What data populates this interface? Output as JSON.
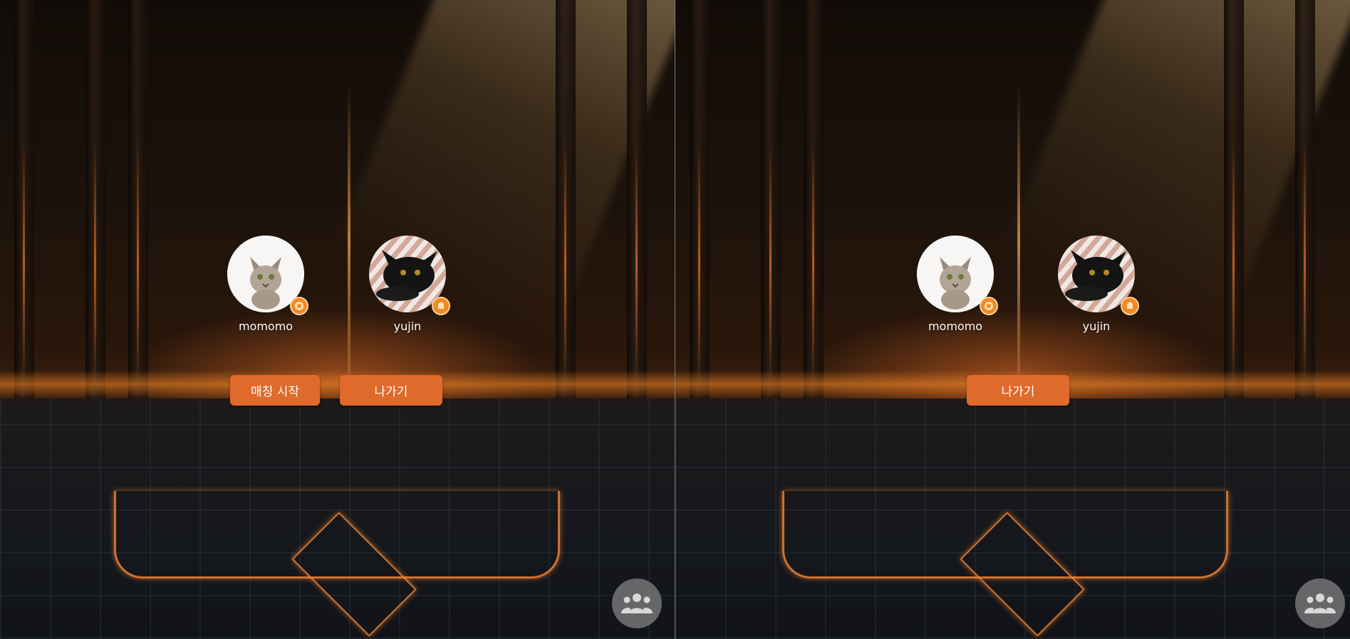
{
  "left_panel": {
    "players": [
      {
        "name": "momomo",
        "avatar": "tabby-kitten-avatar",
        "badge": "orange-level-badge-icon"
      },
      {
        "name": "yujin",
        "avatar": "black-kitten-avatar",
        "badge": "orange-level-badge-icon"
      }
    ],
    "buttons": {
      "start_matching": "매칭 시작",
      "exit": "나가기"
    },
    "group_icon": "group-people-icon"
  },
  "right_panel": {
    "players": [
      {
        "name": "momomo",
        "avatar": "tabby-kitten-avatar",
        "badge": "orange-level-badge-icon"
      },
      {
        "name": "yujin",
        "avatar": "black-kitten-avatar",
        "badge": "orange-level-badge-icon"
      }
    ],
    "buttons": {
      "exit": "나가기"
    },
    "group_icon": "group-people-icon"
  },
  "colors": {
    "button": "#e06a2b",
    "badge": "#f08a24",
    "group_button": "#828282"
  }
}
